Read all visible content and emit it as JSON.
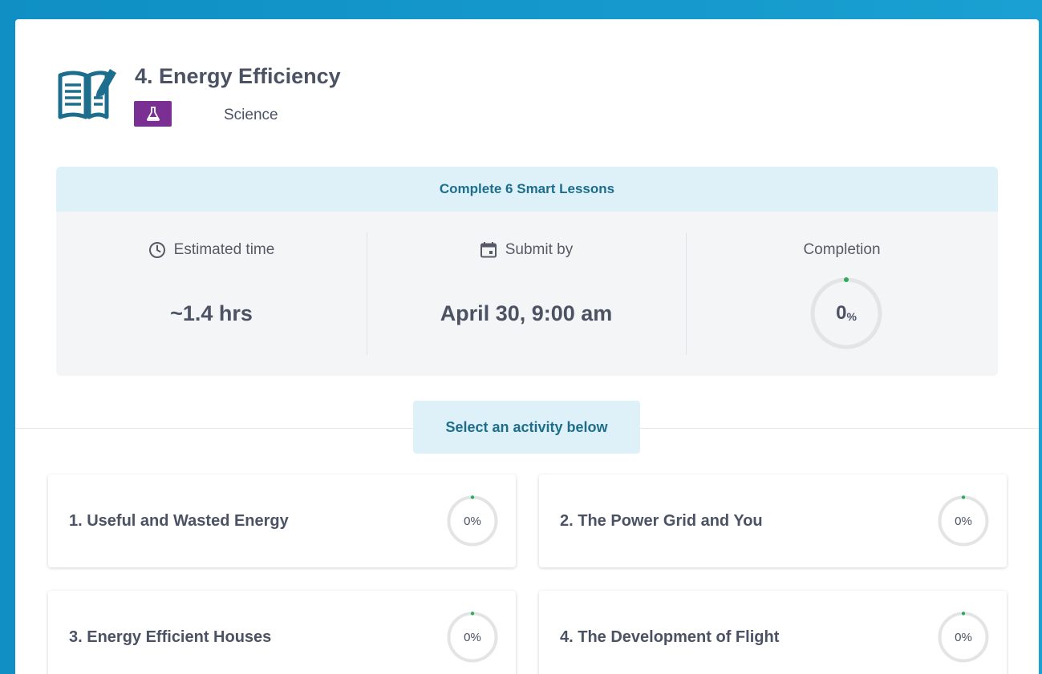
{
  "assignment": {
    "title": "4. Energy Efficiency",
    "subject": "Science",
    "subject_color": "#7a2f93",
    "icon": "book-edit-icon"
  },
  "summary": {
    "heading": "Complete 6 Smart Lessons",
    "estimated_time_label": "Estimated time",
    "estimated_time_value": "~1.4 hrs",
    "submit_by_label": "Submit by",
    "submit_by_value": "April 30, 9:00 am",
    "completion_label": "Completion",
    "completion_value": "0",
    "completion_unit": "%",
    "completion_fraction": 0
  },
  "select_prompt": "Select an activity below",
  "activities": [
    {
      "title": "1. Useful and Wasted Energy",
      "progress": "0%",
      "fraction": 0
    },
    {
      "title": "2. The Power Grid and You",
      "progress": "0%",
      "fraction": 0
    },
    {
      "title": "3. Energy Efficient Houses",
      "progress": "0%",
      "fraction": 0
    },
    {
      "title": "4. The Development of Flight",
      "progress": "0%",
      "fraction": 0
    }
  ],
  "colors": {
    "accent_teal": "#1d6e8c",
    "banner_bg": "#def1f8",
    "progress_green": "#2eab5a",
    "frame_blue": "#1296c8"
  }
}
